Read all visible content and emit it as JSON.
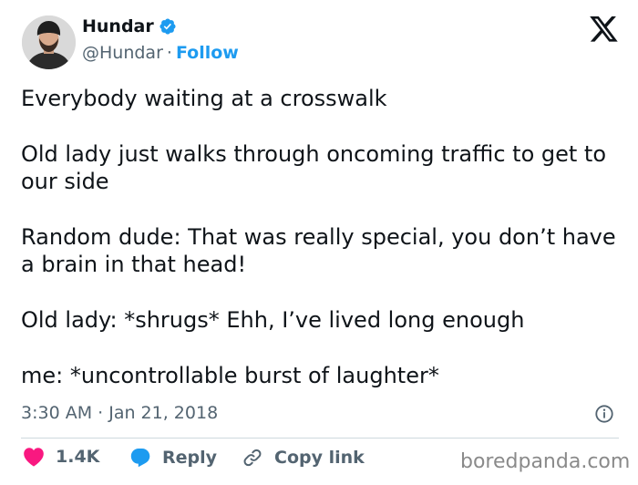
{
  "author": {
    "display_name": "Hundar",
    "handle": "@Hundar",
    "separator": "·",
    "follow_label": "Follow",
    "verified": true
  },
  "tweet": {
    "paragraphs": [
      "Everybody waiting at a crosswalk",
      "Old lady just walks through oncoming traffic to get to our side",
      "Random dude: That was really special, you don’t have a brain in that head!",
      "Old lady: *shrugs* Ehh, I’ve lived long enough",
      "me: *uncontrollable burst of laughter*"
    ],
    "timestamp": "3:30 AM · Jan 21, 2018"
  },
  "actions": {
    "like_count": "1.4K",
    "reply_label": "Reply",
    "copy_link_label": "Copy link"
  },
  "watermark": "boredpanda.com",
  "colors": {
    "accent": "#1d9bf0",
    "like": "#f91880",
    "text": "#0f1419",
    "muted": "#536471"
  },
  "icons": [
    "x-logo-icon",
    "verified-badge-icon",
    "info-icon",
    "heart-icon",
    "reply-bubble-icon",
    "link-icon"
  ]
}
